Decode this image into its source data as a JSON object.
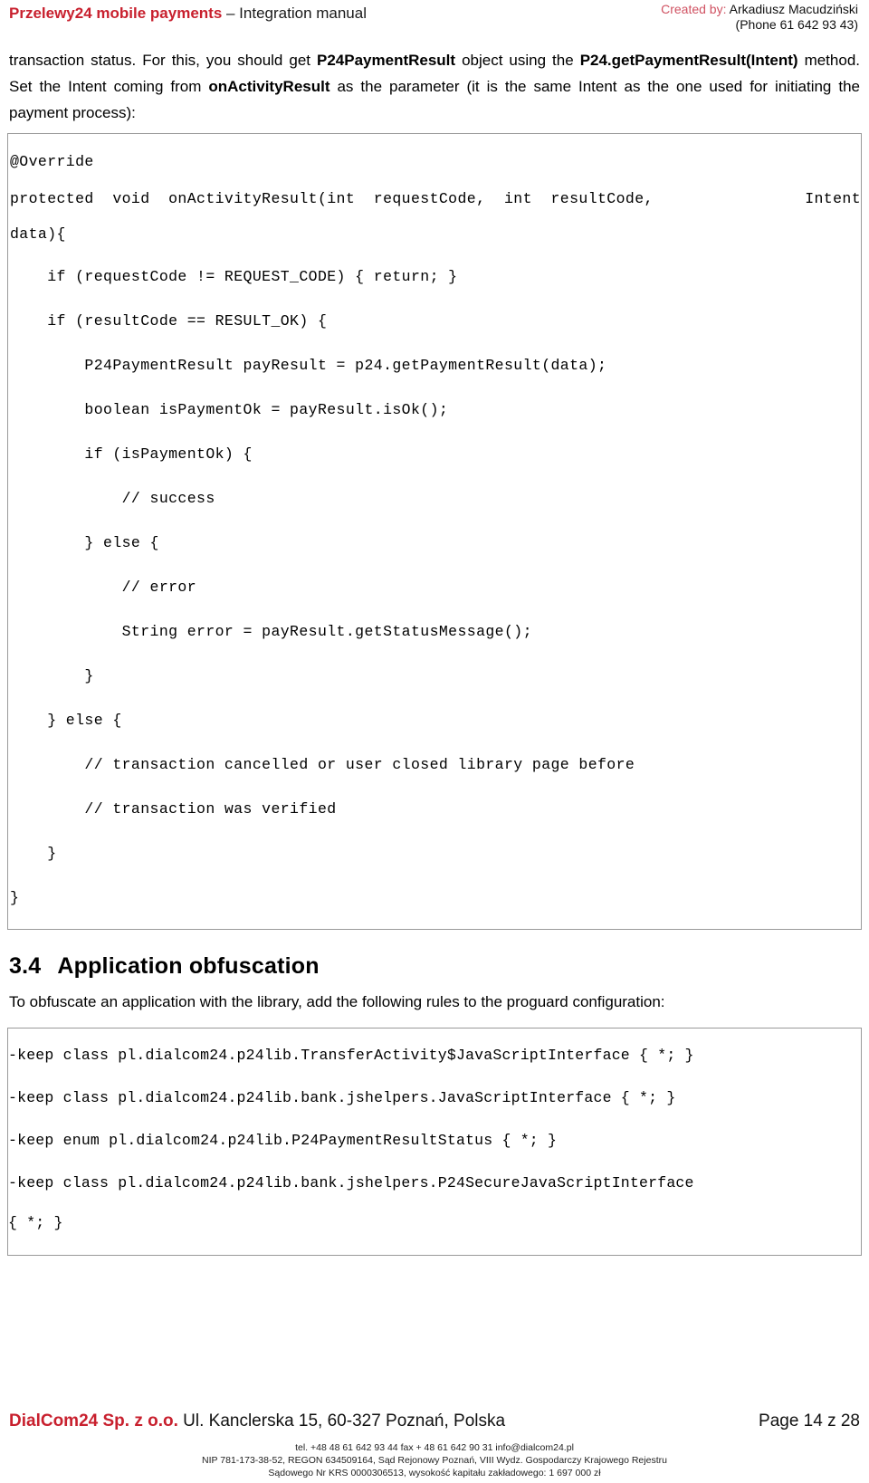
{
  "header": {
    "brand": "Przelewy24 mobile payments",
    "subtitle": " – Integration manual",
    "created_by_label": "Created by:",
    "author": " Arkadiusz Macudziński",
    "phone": "(Phone 61 642 93 43)",
    "brand_color": "#C8202E"
  },
  "intro_paragraph": {
    "part1": "transaction status. For this, you should get ",
    "bold1": "P24PaymentResult",
    "part2": " object using the ",
    "bold2": "P24.getPaymentResult(Intent)",
    "part3": " method. Set the Intent coming from ",
    "bold3": "onActivityResult",
    "part4": " as the parameter (it is the same Intent as the one used for initiating the payment process):"
  },
  "code_block": {
    "line_override": "@Override",
    "line_signature_left": "protected  void  onActivityResult(int  requestCode,  int  resultCode,",
    "line_signature_right": "Intent",
    "line_signature_cont": "data){",
    "lines": [
      "    if (requestCode != REQUEST_CODE) { return; }",
      "    if (resultCode == RESULT_OK) {",
      "        P24PaymentResult payResult = p24.getPaymentResult(data);",
      "        boolean isPaymentOk = payResult.isOk();",
      "        if (isPaymentOk) {",
      "            // success",
      "        } else {",
      "            // error",
      "            String error = payResult.getStatusMessage();",
      "        }",
      "    } else {",
      "        // transaction cancelled or user closed library page before",
      "        // transaction was verified",
      "    }",
      "}"
    ]
  },
  "section": {
    "number": "3.4",
    "title": "Application obfuscation",
    "paragraph": "To obfuscate an application with the library, add the following rules to the proguard configuration:"
  },
  "proguard": {
    "rules": [
      "-keep class pl.dialcom24.p24lib.TransferActivity$JavaScriptInterface { *; }",
      "-keep class pl.dialcom24.p24lib.bank.jshelpers.JavaScriptInterface { *; }",
      "-keep enum pl.dialcom24.p24lib.P24PaymentResultStatus { *; }"
    ],
    "last_rule_line1": "-keep class pl.dialcom24.p24lib.bank.jshelpers.P24SecureJavaScriptInterface",
    "last_rule_line2": "{ *; }"
  },
  "footer": {
    "company": "DialCom24 Sp. z o.o.",
    "address": " Ul. Kanclerska 15, 60-327 Poznań, Polska",
    "page": "Page 14 z 28",
    "fine_line1": "tel. +48 48 61 642 93 44 fax + 48 61 642 90 31 info@dialcom24.pl",
    "fine_line2": "NIP 781-173-38-52, REGON 634509164, Sąd Rejonowy Poznań, VIII Wydz. Gospodarczy Krajowego Rejestru",
    "fine_line3": "Sądowego Nr KRS 0000306513, wysokość kapitału zakładowego: 1 697 000 zł"
  }
}
